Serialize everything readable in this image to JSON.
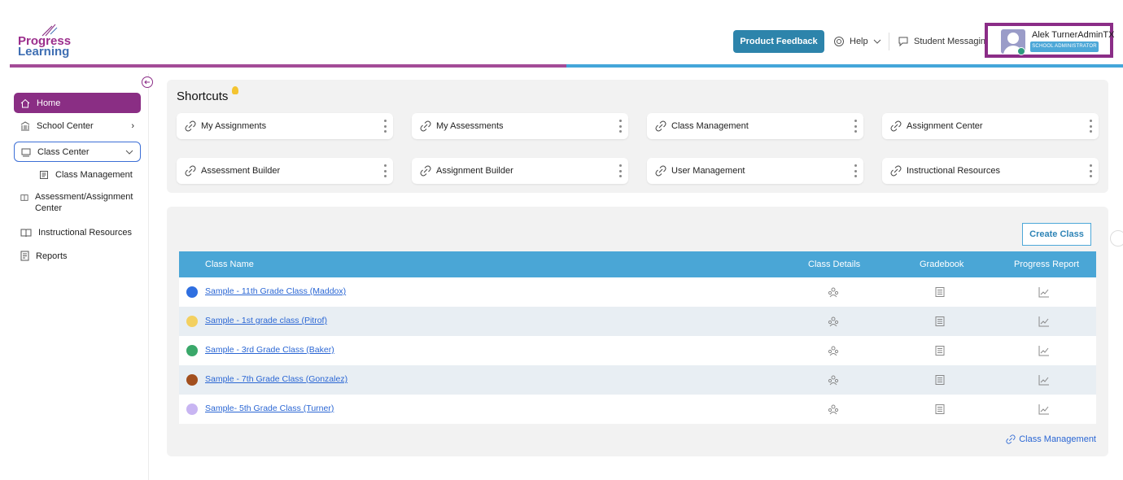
{
  "brand": {
    "line1": "Progress",
    "line2": "Learning"
  },
  "header": {
    "feedback_label": "Product Feedback",
    "help_label": "Help",
    "messaging_label": "Student Messaging",
    "user_name": "Alek TurnerAdminTX",
    "user_role": "SCHOOL ADMINISTRATOR"
  },
  "sidebar": {
    "items": [
      {
        "label": "Home",
        "icon": "home-icon"
      },
      {
        "label": "School Center",
        "icon": "school-icon"
      },
      {
        "label": "Class Center",
        "icon": "class-icon"
      },
      {
        "label": "Class Management",
        "icon": "clipboard-icon"
      },
      {
        "label": "Assessment/Assignment Center",
        "icon": "book-icon"
      },
      {
        "label": "Instructional Resources",
        "icon": "book-open-icon"
      },
      {
        "label": "Reports",
        "icon": "report-icon"
      }
    ]
  },
  "shortcuts": {
    "title": "Shortcuts",
    "items": [
      {
        "label": "My Assignments"
      },
      {
        "label": "My Assessments"
      },
      {
        "label": "Class Management"
      },
      {
        "label": "Assignment Center"
      },
      {
        "label": "Assessment Builder"
      },
      {
        "label": "Assignment Builder"
      },
      {
        "label": "User Management"
      },
      {
        "label": "Instructional Resources"
      }
    ]
  },
  "classes": {
    "create_label": "Create Class",
    "columns": [
      "Class Name",
      "Class Details",
      "Gradebook",
      "Progress Report"
    ],
    "rows": [
      {
        "name": "Sample - 11th Grade Class (Maddox)",
        "color": "#2f6fe0"
      },
      {
        "name": "Sample - 1st grade class (Pitrof)",
        "color": "#f3d060"
      },
      {
        "name": "Sample - 3rd Grade Class (Baker)",
        "color": "#3aa86a"
      },
      {
        "name": "Sample - 7th Grade Class (Gonzalez)",
        "color": "#a24f1e"
      },
      {
        "name": "Sample- 5th Grade Class (Turner)",
        "color": "#c8b5f2"
      }
    ],
    "footer_link": "Class Management"
  },
  "colors": {
    "brand_purple": "#8a2e84",
    "accent_blue": "#4aa6d6",
    "link_blue": "#2a66d4"
  }
}
